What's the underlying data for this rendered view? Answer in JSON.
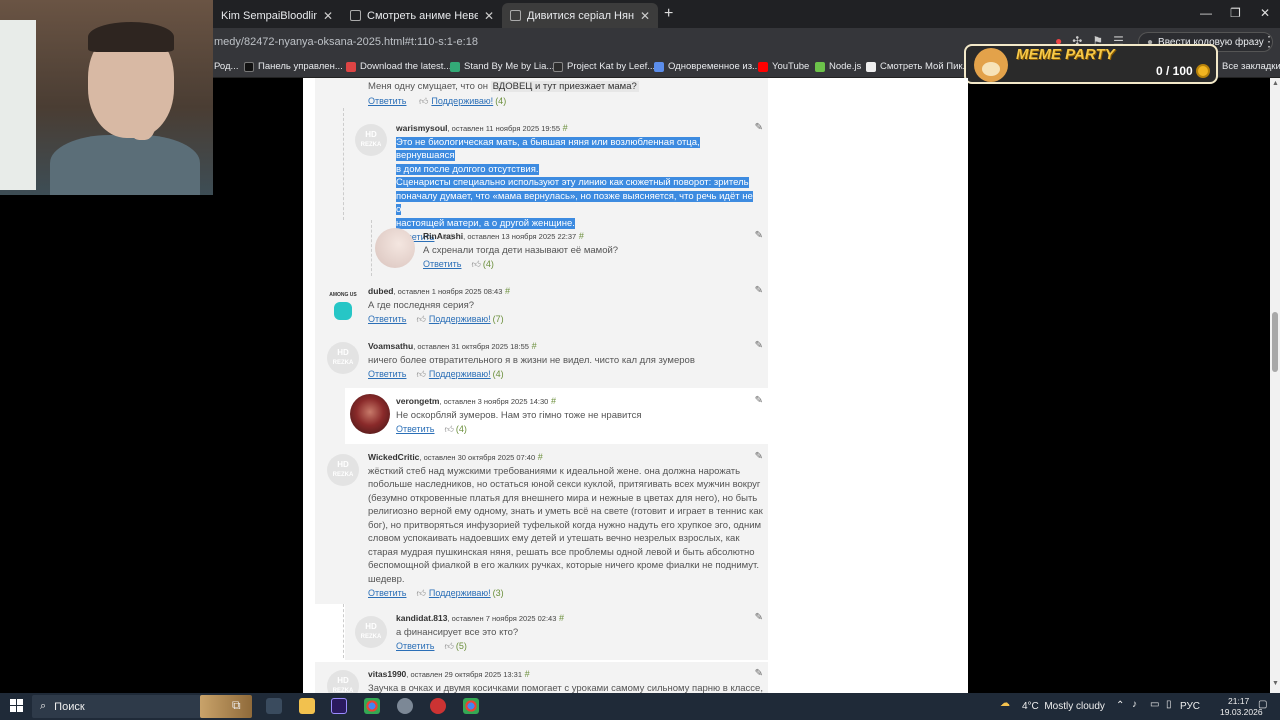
{
  "browser": {
    "tabs": [
      {
        "title": "Kim SempaiBloodlines Stream - Wat",
        "active": false
      },
      {
        "title": "Смотреть аниме Невероятные",
        "active": false
      },
      {
        "title": "Дивитися серіал Няня Оксана",
        "active": true
      }
    ],
    "url": "medy/82472-nyanya-oksana-2025.html#t:110-s:1-e:18",
    "code_button": "Ввести кодовую фразу",
    "bookmarks": [
      "Род...",
      "Панель управлен...",
      "Download the latest...",
      "Stand By Me by Lia...",
      "Project Kat by Leef...",
      "Одновременное из...",
      "YouTube",
      "Node.js",
      "Смотреть Мой Пик..."
    ],
    "all_bookmarks": "Все закладки"
  },
  "meme_party": {
    "title": "MEME PARTY",
    "score": "0 / 100"
  },
  "comments": [
    {
      "text": "Меня одну смущает, что он ",
      "highlight": "ВДОВЕЦ и тут приезжает мама?",
      "reply": "Ответить",
      "support": "Поддерживаю!",
      "count": "(4)"
    },
    {
      "nick": "warismysoul",
      "meta": ", оставлен 11 ноября 2025 19:55",
      "hash": "#",
      "lines": [
        "Это не биологическая мать, а бывшая няня или возлюбленная отца, вернувшаяся",
        "в дом после долгого отсутствия.",
        "Сценаристы специально используют эту линию как сюжетный поворот: зритель",
        "поначалу думает, что «мама вернулась», но позже выясняется, что речь идёт не о",
        "настоящей матери, а о другой женщине."
      ],
      "reply": "Ответить"
    },
    {
      "nick": "RinArashi",
      "meta": ", оставлен 13 ноября 2025 22:37",
      "hash": "#",
      "text": "А схренали тогда дети называют её мамой?",
      "reply": "Ответить",
      "count": "(4)"
    },
    {
      "nick": "dubed",
      "meta": ", оставлен 1 ноября 2025 08:43",
      "hash": "#",
      "text": "А где последняя серия?",
      "reply": "Ответить",
      "support": "Поддерживаю!",
      "count": "(7)"
    },
    {
      "nick": "Voamsathu",
      "meta": ", оставлен 31 октября 2025 18:55",
      "hash": "#",
      "text": "ничего более отвратительного я в жизни не видел. чисто кал для зумеров",
      "reply": "Ответить",
      "support": "Поддерживаю!",
      "count": "(4)"
    },
    {
      "nick": "verongetm",
      "meta": ", оставлен 3 ноября 2025 14:30",
      "hash": "#",
      "text": "Не оскорбляй зумеров. Нам это гімно тоже не нравится",
      "reply": "Ответить",
      "count": "(4)"
    },
    {
      "nick": "WickedCritic",
      "meta": ", оставлен 30 октября 2025 07:40",
      "hash": "#",
      "lines": [
        "жёсткий стеб над мужскими требованиями к идеальной жене. она должна нарожать",
        "побольше наследников, но остаться юной секси куклой, притягивать всех мужчин вокруг",
        "(безумно откровенные платья для внешнего мира и нежные в цветах для него), но быть",
        "религиозно верной ему одному, знать и уметь всё на свете (готовит и играет в теннис как",
        "бог), но притворяться инфузорией туфелькой когда нужно надуть его хрупкое эго, одним",
        "словом успокаивать надоевших ему детей и утешать вечно незрелых взрослых, как",
        "старая мудрая пушкинская няня, решать все проблемы одной левой и быть абсолютно",
        "беспомощной фиалкой в его жалких ручках, которые ничего кроме фиалки не поднимут.",
        "шедевр."
      ],
      "reply": "Ответить",
      "support": "Поддерживаю!",
      "count": "(3)"
    },
    {
      "nick": "kandidat.813",
      "meta": ", оставлен 7 ноября 2025 02:43",
      "hash": "#",
      "text": "а финансирует все это кто?",
      "reply": "Ответить",
      "count": "(5)"
    },
    {
      "nick": "vitas1990",
      "meta": ", оставлен 29 октября 2025 13:31",
      "hash": "#",
      "text": "Заучка в очках и двумя косичками помогает с уроками самому сильному парню в классе,"
    }
  ],
  "avatar_label": {
    "hd": "HD",
    "brand": "REZKA",
    "among": "AMONG US"
  },
  "taskbar": {
    "search": "Поиск",
    "weather": "4°C  Mostly cloudy",
    "lang": "РУС",
    "time": "21:17",
    "date": "19.03.2026"
  }
}
